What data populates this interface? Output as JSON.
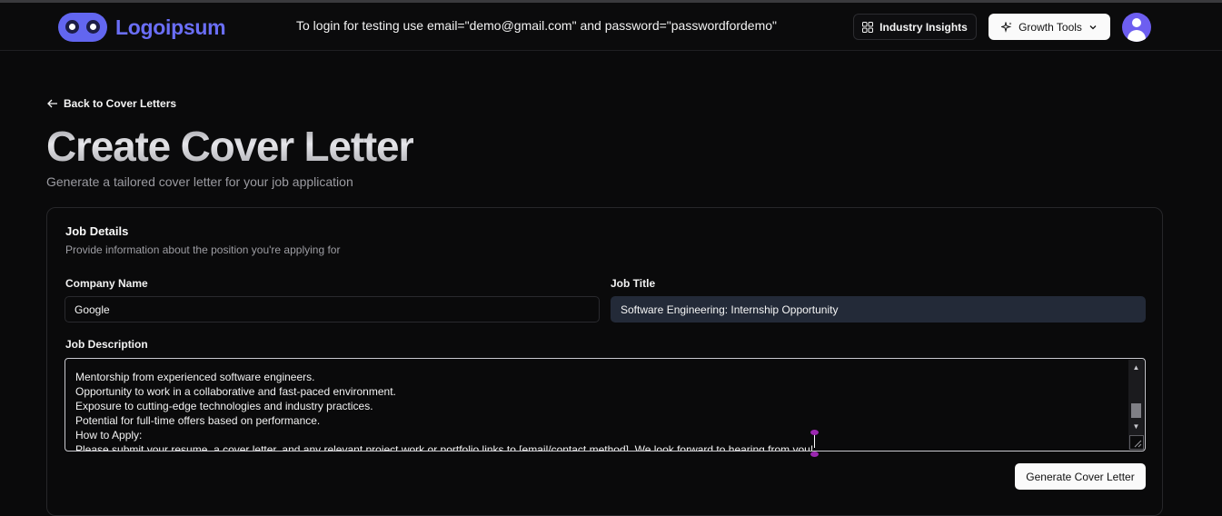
{
  "header": {
    "logo_text": "Logoipsum",
    "notice": "To login for testing use email=\"demo@gmail.com\" and password=\"passwordfordemo\"",
    "industry_insights_label": "Industry Insights",
    "growth_tools_label": "Growth Tools",
    "icons": [
      "grid-icon",
      "sparkle-icon",
      "chevron-down-icon",
      "user-avatar-icon"
    ]
  },
  "back_link": "Back to Cover Letters",
  "page": {
    "title": "Create Cover Letter",
    "subtitle": "Generate a tailored cover letter for your job application"
  },
  "card": {
    "title": "Job Details",
    "subtitle": "Provide information about the position you're applying for",
    "company_label": "Company Name",
    "company_value": "Google",
    "job_title_label": "Job Title",
    "job_title_value": "Software Engineering: Internship Opportunity",
    "description_label": "Job Description",
    "description_lines": [
      "Mentorship from experienced software engineers.",
      "Opportunity to work in a collaborative and fast-paced environment.",
      "Exposure to cutting-edge technologies and industry practices.",
      "Potential for full-time offers based on performance.",
      "How to Apply:",
      "Please submit your resume, a cover letter, and any relevant project work or portfolio links to [email/contact method]. We look forward to hearing from you!"
    ],
    "generate_label": "Generate Cover Letter"
  },
  "colors": {
    "background": "#0a0a0b",
    "brand": "#6266f0",
    "avatar": "#6d5ef0",
    "filled_input": "#232a38",
    "selection_handle": "#9b27b0"
  }
}
